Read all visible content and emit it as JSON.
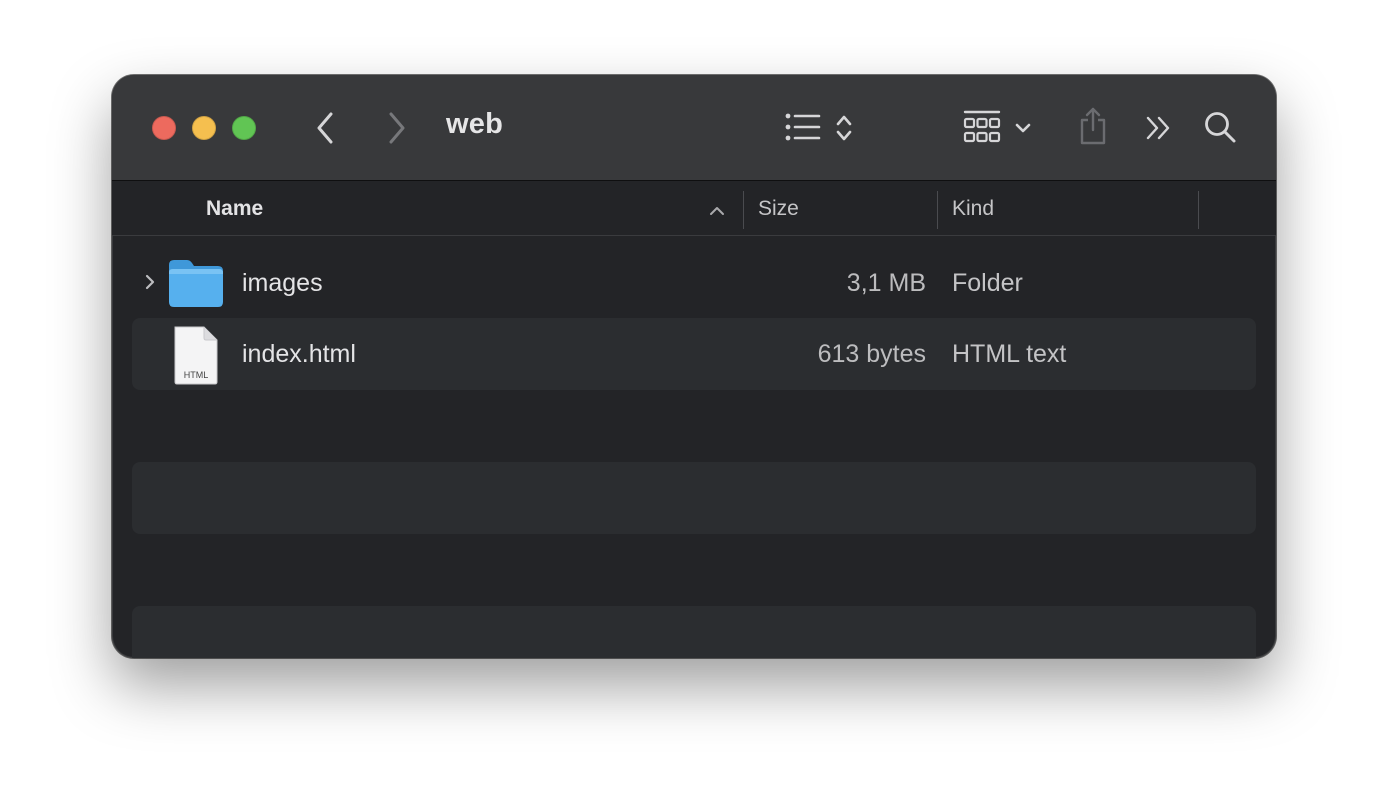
{
  "window": {
    "title": "web"
  },
  "toolbar": {
    "icons": [
      "back-icon",
      "forward-icon",
      "list-view-icon",
      "sort-stepper-icon",
      "grid-view-icon",
      "chevron-down-icon",
      "share-icon",
      "more-icon",
      "search-icon"
    ]
  },
  "columns": {
    "name": "Name",
    "size": "Size",
    "kind": "Kind",
    "sort_direction": "ascending"
  },
  "files": [
    {
      "name": "images",
      "size": "3,1 MB",
      "kind": "Folder",
      "icon": "folder-icon"
    },
    {
      "name": "index.html",
      "size": "613 bytes",
      "kind": "HTML text",
      "icon": "html-file-icon",
      "icon_label": "HTML"
    }
  ],
  "colors": {
    "close": "#ed6a5e",
    "minimize": "#f5bf4f",
    "maximize": "#61c554",
    "folder": "#4aa9e9"
  }
}
